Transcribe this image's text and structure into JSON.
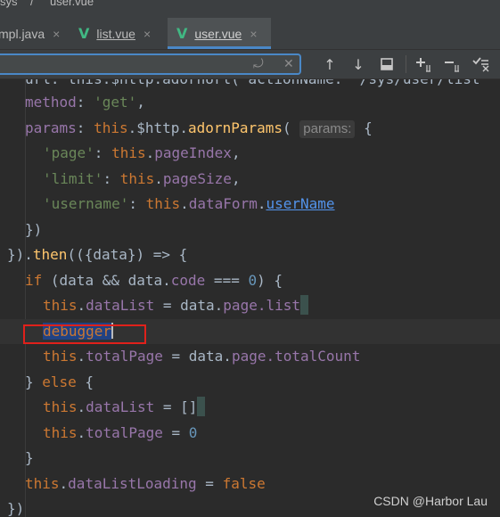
{
  "breadcrumb": {
    "left": "sys",
    "separator": "/",
    "file": "user.vue"
  },
  "tabs": [
    {
      "label": "mpl.java",
      "close": "×"
    },
    {
      "label": "list.vue",
      "close": "×"
    },
    {
      "label": "user.vue",
      "close": "×",
      "active": true
    }
  ],
  "search": {
    "value": "",
    "placeholder": "",
    "icons": [
      "regex-replace-icon",
      "clear-icon"
    ]
  },
  "toolbar_icons": [
    "previous-occurrence-icon",
    "next-occurrence-icon",
    "filter-icon",
    "add-selection-icon",
    "remove-selection-icon",
    "select-all-icon"
  ],
  "code": {
    "line0": "url: this.$http.adornUrl( actionName: '/sys/user/list",
    "line1_prop": "method",
    "line1_val": "'get'",
    "line2_prop": "params",
    "line2_this": "this",
    "line2_obj": ".$http.",
    "line2_fn": "adornParams",
    "line2_hint": "params:",
    "line3_key": "'page'",
    "line3_prop": "pageIndex",
    "line4_key": "'limit'",
    "line4_prop": "pageSize",
    "line5_key": "'username'",
    "line5_prop": "dataForm",
    "line5_link": "userName",
    "line7_fn": "then",
    "line7_rest": "(({data}) => {",
    "line8_kw": "if",
    "line8_a": "(data && data.",
    "line8_prop": "code",
    "line8_b": " === ",
    "line8_num": "0",
    "line8_c": ") {",
    "line9_prop": "dataList",
    "line9_rest": " = data.",
    "line9_page": "page",
    "line9_list": ".list",
    "line10_kw": "debugger",
    "line11_prop": "totalPage",
    "line11_rest": " = data.",
    "line11_page": "page",
    "line11_count": ".totalCount",
    "line12_else": "else",
    "line13_prop": "dataList",
    "line13_rest": " = []",
    "line14_prop": "totalPage",
    "line14_num": "0",
    "line16_prop": "dataListLoading",
    "line16_kw": "false",
    "this_kw": "this"
  },
  "watermark": "CSDN @Harbor Lau",
  "colors": {
    "background": "#2b2b2b",
    "keyword": "#cc7832",
    "string": "#6a8759",
    "function": "#ffc66d",
    "property": "#9876aa",
    "number": "#6897bb",
    "highlight_box": "#e0211b",
    "vue_icon": "#41b883"
  }
}
